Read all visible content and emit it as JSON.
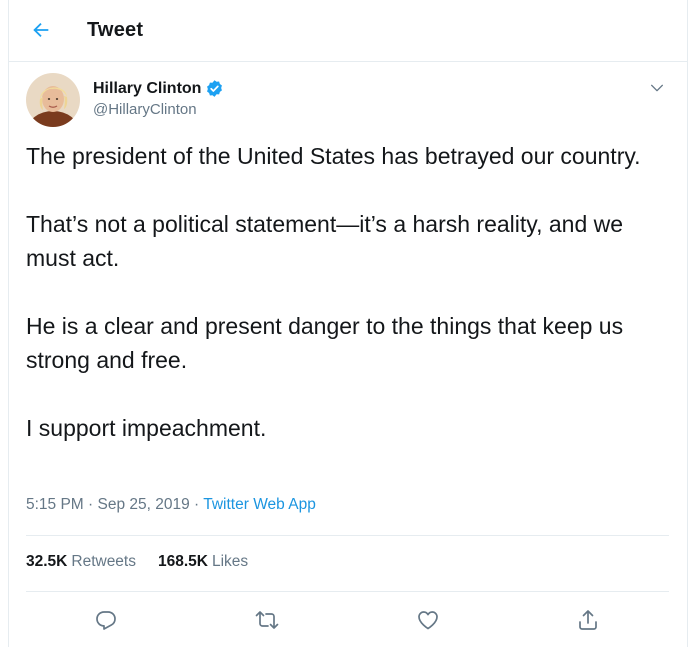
{
  "header": {
    "title": "Tweet",
    "back_icon": "arrow-left-icon"
  },
  "author": {
    "name": "Hillary Clinton",
    "handle": "@HillaryClinton",
    "verified": true
  },
  "tweet": {
    "paragraphs": [
      "The president of the United States has betrayed our country.",
      "That’s not a political statement—it’s a harsh reality, and we must act.",
      "He is a clear and present danger to the things that keep us strong and free.",
      "I support impeachment."
    ]
  },
  "meta": {
    "time": "5:15 PM",
    "dot1": " · ",
    "date": "Sep 25, 2019",
    "dot2": " · ",
    "source": "Twitter Web App"
  },
  "stats": {
    "retweets_count": "32.5K",
    "retweets_label": "Retweets",
    "likes_count": "168.5K",
    "likes_label": "Likes"
  },
  "actions": [
    "reply-icon",
    "retweet-icon",
    "like-icon",
    "share-icon"
  ],
  "colors": {
    "accent": "#1da1f2",
    "text": "#14171a",
    "secondary": "#657786",
    "border": "#e6ecf0"
  }
}
